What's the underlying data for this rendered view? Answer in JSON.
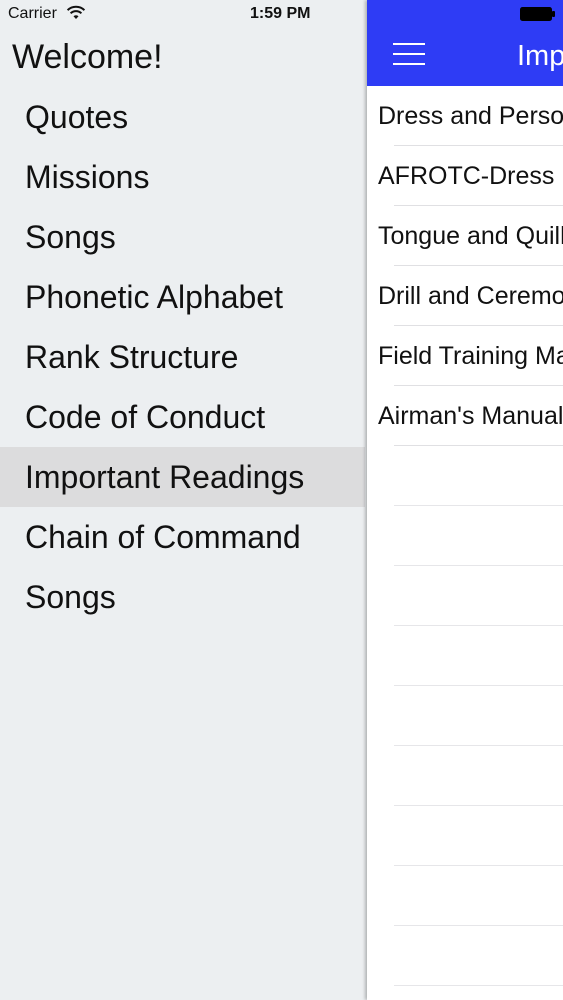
{
  "status_bar": {
    "carrier": "Carrier",
    "time": "1:59 PM",
    "wifi_icon": "wifi-icon",
    "battery_icon": "battery-icon"
  },
  "menu": {
    "header": "Welcome!",
    "items": [
      {
        "label": "Quotes"
      },
      {
        "label": "Missions"
      },
      {
        "label": "Songs"
      },
      {
        "label": "Phonetic Alphabet"
      },
      {
        "label": "Rank Structure"
      },
      {
        "label": "Code of Conduct"
      },
      {
        "label": "Important Readings",
        "selected": true
      },
      {
        "label": "Chain of Command"
      },
      {
        "label": "Songs"
      }
    ]
  },
  "main": {
    "title": "Important Readings",
    "menu_icon": "hamburger-menu-icon",
    "accent_color": "#2e3cf5",
    "readings": [
      {
        "label": "Dress and Personal Appearance"
      },
      {
        "label": "AFROTC-Dress"
      },
      {
        "label": "Tongue and Quill"
      },
      {
        "label": "Drill and Ceremonies"
      },
      {
        "label": "Field Training Manual"
      },
      {
        "label": "Airman's Manual"
      }
    ]
  }
}
